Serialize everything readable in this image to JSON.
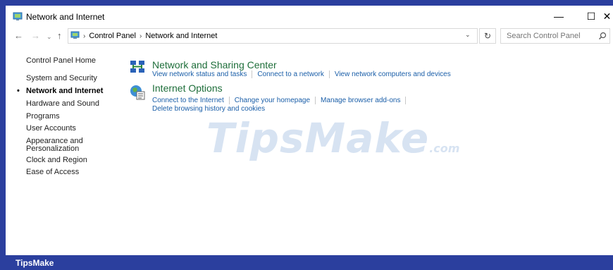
{
  "window": {
    "title": "Network and Internet",
    "controls": {
      "minimize": "—",
      "maximize": "☐",
      "close": "✕"
    }
  },
  "toolbar": {
    "back_icon": "←",
    "forward_icon": "→",
    "recent_icon": "⌄",
    "up_icon": "↑",
    "breadcrumbs": [
      "Control Panel",
      "Network and Internet"
    ],
    "separator": "›",
    "dropdown_icon": "⌄",
    "refresh_icon": "↻",
    "search_placeholder": "Search Control Panel"
  },
  "sidebar": {
    "items": [
      {
        "label": "Control Panel Home",
        "active": false
      },
      {
        "label": "System and Security",
        "active": false
      },
      {
        "label": "Network and Internet",
        "active": true
      },
      {
        "label": "Hardware and Sound",
        "active": false
      },
      {
        "label": "Programs",
        "active": false
      },
      {
        "label": "User Accounts",
        "active": false
      },
      {
        "label": "Appearance and",
        "active": false
      },
      {
        "label": "Personalization",
        "active": false
      },
      {
        "label": "Clock and Region",
        "active": false
      },
      {
        "label": "Ease of Access",
        "active": false
      }
    ],
    "bullet": "•"
  },
  "categories": [
    {
      "title": "Network and Sharing Center",
      "icon": "network-sharing-icon",
      "links": [
        "View network status and tasks",
        "Connect to a network",
        "View network computers and devices"
      ]
    },
    {
      "title": "Internet Options",
      "icon": "internet-options-icon",
      "links": [
        "Connect to the Internet",
        "Change your homepage",
        "Manage browser add-ons"
      ],
      "links_row2": [
        "Delete browsing history and cookies"
      ]
    }
  ],
  "watermark": {
    "main": "TipsMake",
    "suffix": ".com"
  },
  "footer": {
    "brand": "TipsMake"
  },
  "colors": {
    "frame": "#2b3f9e",
    "category_title": "#1e6e3a",
    "link": "#1a5ea8",
    "watermark": "#d7e3f2"
  }
}
